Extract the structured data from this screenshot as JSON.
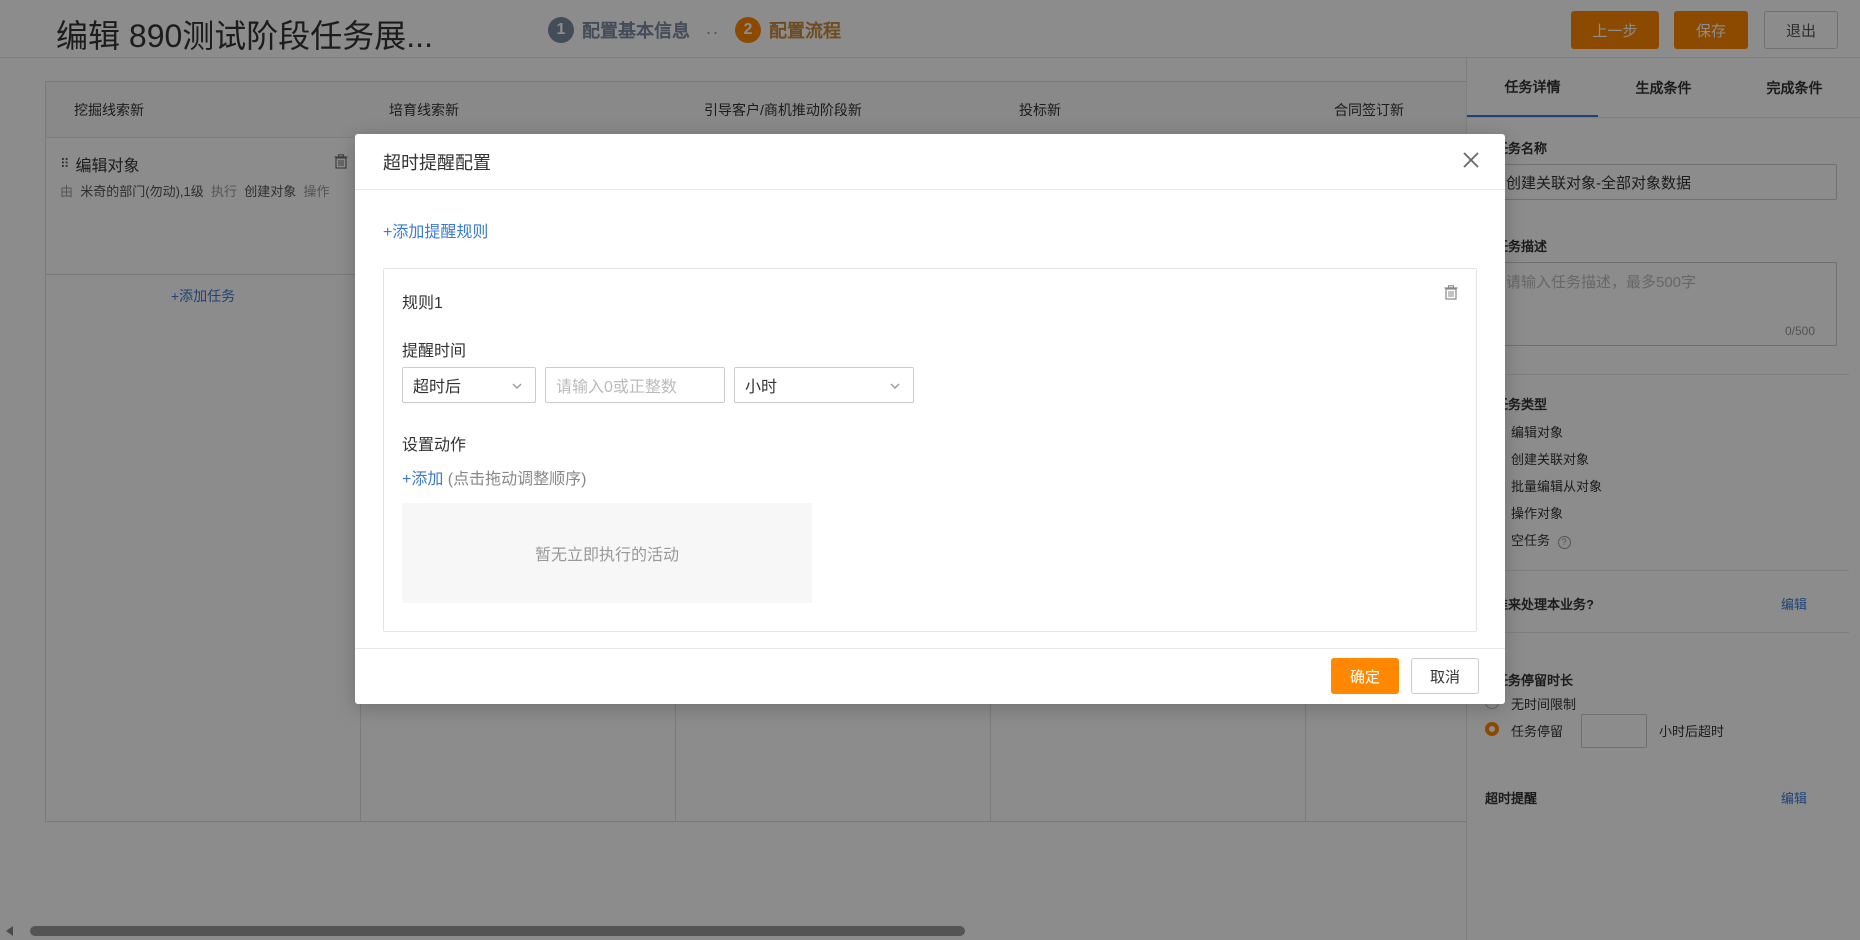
{
  "header": {
    "title": "编辑 890测试阶段任务展...",
    "steps": [
      {
        "num": "1",
        "label": "配置基本信息"
      },
      {
        "num": "2",
        "label": "配置流程"
      }
    ],
    "step_separator": "..",
    "prev_label": "上一步",
    "save_label": "保存",
    "exit_label": "退出"
  },
  "board": {
    "columns": [
      "挖掘线索新",
      "培育线索新",
      "引导客户/商机推动阶段新",
      "投标新",
      "合同签订新"
    ],
    "task": {
      "title": "编辑对象",
      "desc_prefix": "由",
      "desc_dept": "米奇的部门(勿动),1级",
      "desc_exec": "执行",
      "desc_action": "创建对象",
      "desc_op": "操作"
    },
    "add_task_label": "+添加任务"
  },
  "panel": {
    "tabs": [
      "任务详情",
      "生成条件",
      "完成条件"
    ],
    "name_label": "任务名称",
    "name_value": "创建关联对象-全部对象数据",
    "desc_label": "任务描述",
    "desc_placeholder": "请输入任务描述，最多500字",
    "desc_count": "0/500",
    "type_label": "任务类型",
    "types": [
      "编辑对象",
      "创建关联对象",
      "批量编辑从对象",
      "操作对象",
      "空任务"
    ],
    "handler_label": "谁来处理本业务?",
    "edit_label": "编辑",
    "duration_label": "任务停留时长",
    "no_limit": "无时间限制",
    "stay_label": "任务停留",
    "stay_suffix": "小时后超时",
    "timeout_label": "超时提醒",
    "timeout_edit": "编辑"
  },
  "modal": {
    "title": "超时提醒配置",
    "add_rule": "+添加提醒规则",
    "rule_title": "规则1",
    "remind_time_label": "提醒时间",
    "timing_value": "超时后",
    "amount_placeholder": "请输入0或正整数",
    "unit_value": "小时",
    "action_label": "设置动作",
    "add_action": "+添加",
    "add_action_hint": " (点击拖动调整顺序)",
    "empty_text": "暂无立即执行的活动",
    "ok_label": "确定",
    "cancel_label": "取消"
  },
  "colors": {
    "accent": "#ff8800",
    "link": "#3a7bd5"
  }
}
